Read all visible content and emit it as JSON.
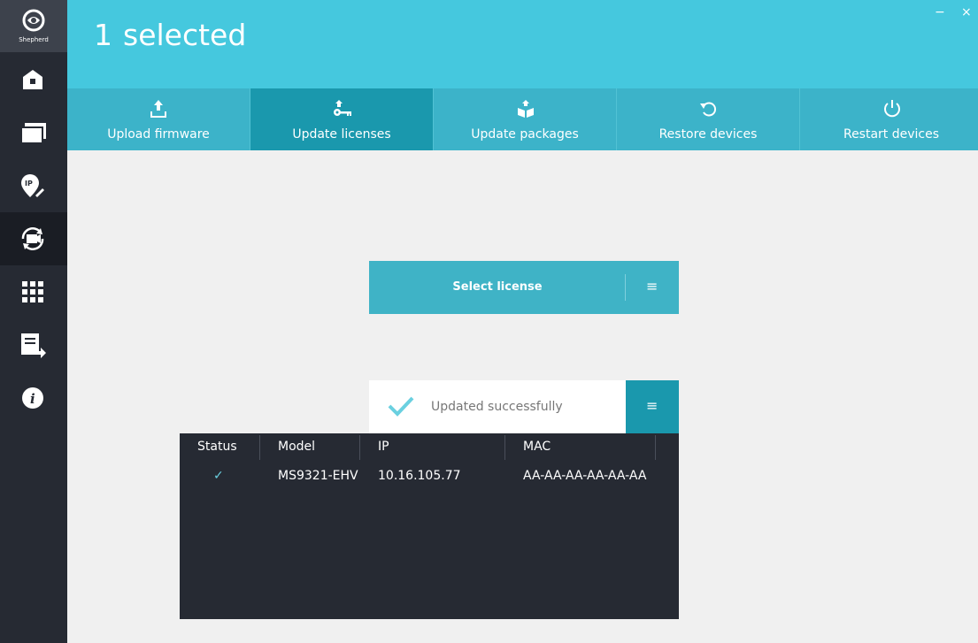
{
  "app": {
    "logo_text": "Shepherd"
  },
  "sidebar": {
    "items": [
      {
        "icon": "home-icon"
      },
      {
        "icon": "devices-icon"
      },
      {
        "icon": "ip-icon"
      },
      {
        "icon": "sync-camera-icon",
        "active": true
      },
      {
        "icon": "grid-icon"
      },
      {
        "icon": "export-doc-icon"
      },
      {
        "icon": "info-icon"
      }
    ]
  },
  "header": {
    "count": "1",
    "selected_label": "selected",
    "minimize": "−",
    "close": "×"
  },
  "toolbar": {
    "tabs": [
      {
        "label": "Upload firmware",
        "icon": "upload-icon"
      },
      {
        "label": "Update licenses",
        "icon": "key-icon",
        "active": true
      },
      {
        "label": "Update packages",
        "icon": "package-icon"
      },
      {
        "label": "Restore devices",
        "icon": "restore-icon"
      },
      {
        "label": "Restart devices",
        "icon": "power-icon"
      }
    ]
  },
  "license": {
    "label": "Select license",
    "menu": "≡"
  },
  "status": {
    "message": "Updated successfully",
    "menu": "≡"
  },
  "table": {
    "columns": [
      "Status",
      "Model",
      "IP",
      "MAC"
    ],
    "rows": [
      {
        "status": "✓",
        "model": "MS9321-EHV",
        "ip": "10.16.105.77",
        "mac": "AA-AA-AA-AA-AA-AA"
      }
    ]
  },
  "colors": {
    "accent": "#45c8de",
    "accent_dark": "#1a98ad",
    "sidebar": "#262a33"
  }
}
